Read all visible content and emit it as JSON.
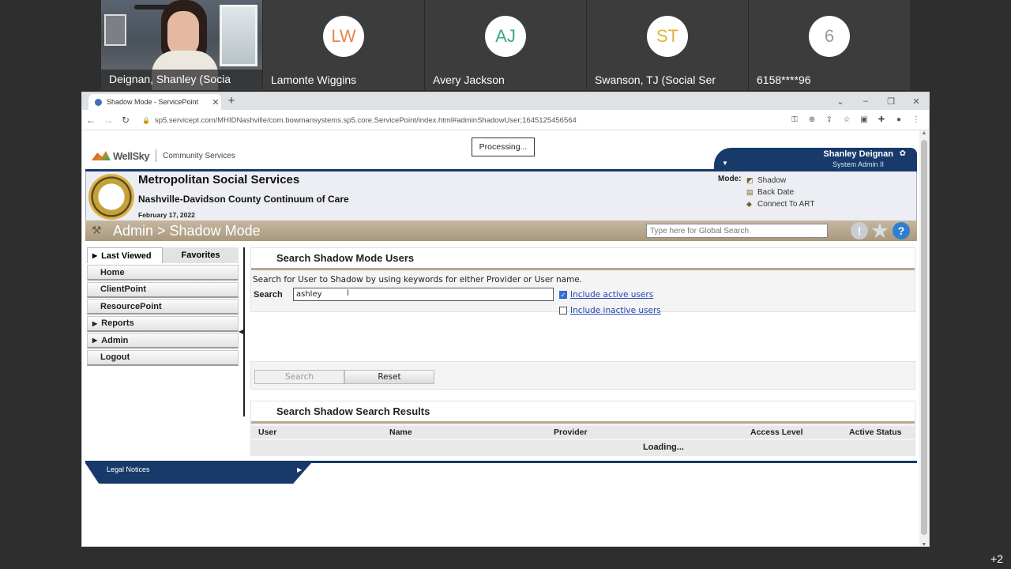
{
  "call": {
    "participants": [
      {
        "name": "Deignan, Shanley (Socia",
        "initials": "",
        "type": "video"
      },
      {
        "name": "Lamonte Wiggins",
        "initials": "LW",
        "color": "#e8864a"
      },
      {
        "name": "Avery Jackson",
        "initials": "AJ",
        "color": "#3aa68a"
      },
      {
        "name": "Swanson, TJ (Social Ser",
        "initials": "ST",
        "color": "#e0b43a"
      },
      {
        "name": "6158****96",
        "initials": "6",
        "color": "#9a9a9a"
      }
    ],
    "more_count": "+2"
  },
  "browser": {
    "tab_title": "Shadow Mode - ServicePoint",
    "url": "sp5.servicept.com/MHIDNashville/com.bowmansystems.sp5.core.ServicePoint/index.html#adminShadowUser;1645125456564"
  },
  "app": {
    "brand": "WellSky",
    "product": "Community Services",
    "processing": "Processing...",
    "user_name": "Shanley Deignan",
    "user_role": "System Admin II",
    "org_name": "Metropolitan Social Services",
    "coc_name": "Nashville-Davidson County Continuum of Care",
    "date": "February 17, 2022",
    "mode_label": "Mode:",
    "mode_items": [
      "Shadow",
      "Back Date",
      "Connect To ART"
    ],
    "page_title": "Admin > Shadow Mode",
    "global_search_placeholder": "Type here for Global Search"
  },
  "sidebar": {
    "tabs": [
      "Last Viewed",
      "Favorites"
    ],
    "items": [
      "Home",
      "ClientPoint",
      "ResourcePoint",
      "Reports",
      "Admin",
      "Logout"
    ]
  },
  "search_panel": {
    "title": "Search Shadow Mode Users",
    "hint": "Search for User to Shadow by using keywords for either Provider or User name.",
    "search_label": "Search",
    "search_value": "ashley",
    "include_active": "Include active users",
    "include_inactive": "Include inactive users",
    "search_button": "Search",
    "reset_button": "Reset"
  },
  "results_panel": {
    "title": "Search Shadow Search Results",
    "columns": [
      "User",
      "Name",
      "Provider",
      "Access Level",
      "Active Status"
    ],
    "loading": "Loading..."
  },
  "footer": {
    "legal": "Legal Notices"
  }
}
